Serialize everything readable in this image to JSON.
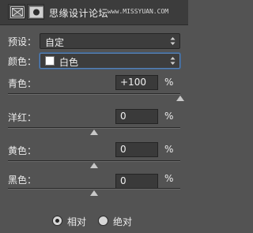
{
  "header": {
    "site_title": "思缘设计论坛",
    "site_url": "www.MISSYUAN.COM",
    "icons": [
      "adjustment-layer-icon",
      "mask-icon"
    ]
  },
  "preset": {
    "label": "预设：",
    "value": "自定"
  },
  "colors": {
    "label": "颜色：",
    "value": "白色",
    "swatch": "#ffffff"
  },
  "sliders": [
    {
      "label": "青色：",
      "value": "+100",
      "unit": "%",
      "position": 1.0
    },
    {
      "label": "洋红：",
      "value": "0",
      "unit": "%",
      "position": 0.5
    },
    {
      "label": "黄色：",
      "value": "0",
      "unit": "%",
      "position": 0.5
    },
    {
      "label": "黑色：",
      "value": "0",
      "unit": "%",
      "position": 0.5
    }
  ],
  "method": {
    "options": [
      {
        "label": "相对",
        "selected": true
      },
      {
        "label": "绝对",
        "selected": false
      }
    ]
  }
}
